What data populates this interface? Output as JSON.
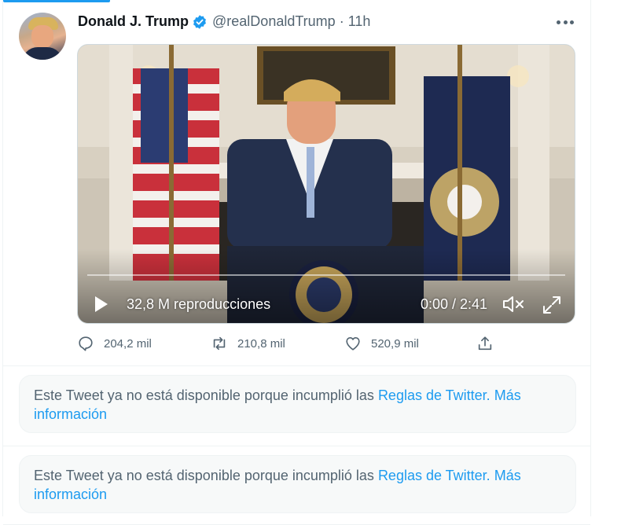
{
  "tweet": {
    "author_name": "Donald J. Trump",
    "handle": "@realDonaldTrump",
    "separator": "·",
    "time": "11h",
    "verified_icon": "verified-badge-icon",
    "more_icon": "more-options-icon",
    "video": {
      "views": "32,8 M reproducciones",
      "duration": "0:00 / 2:41",
      "progress": 0,
      "play_icon": "play-icon",
      "mute_icon": "volume-muted-icon",
      "fullscreen_icon": "fullscreen-icon"
    },
    "actions": {
      "replies": "204,2 mil",
      "retweets": "210,8 mil",
      "likes": "520,9 mil"
    }
  },
  "notices": [
    {
      "text": "Este Tweet ya no está disponible porque incumplió las ",
      "rules_link": "Reglas de Twitter.",
      "more_link": "Más información"
    },
    {
      "text": "Este Tweet ya no está disponible porque incumplió las ",
      "rules_link": "Reglas de Twitter.",
      "more_link": "Más información"
    }
  ],
  "colors": {
    "accent": "#1d9bf0",
    "text_secondary": "#536471",
    "notice_bg": "#f7f9f9"
  }
}
